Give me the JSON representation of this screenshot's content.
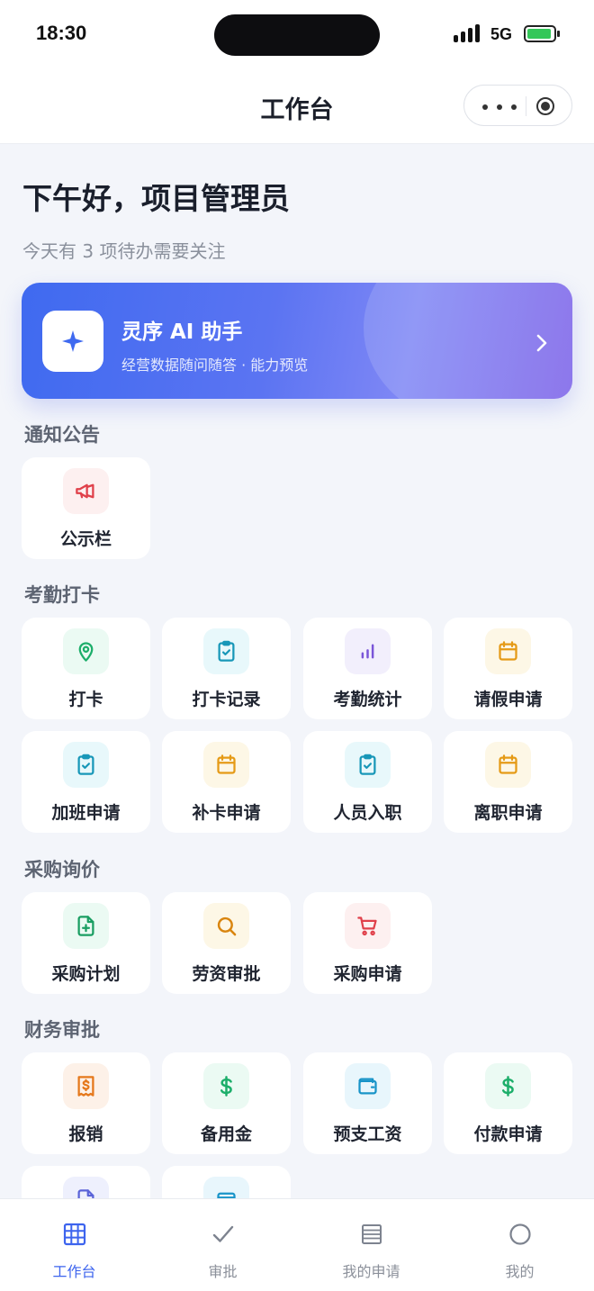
{
  "status_bar": {
    "time": "18:30",
    "network": "5G"
  },
  "nav": {
    "title": "工作台"
  },
  "header": {
    "greeting": "下午好，项目管理员",
    "subtitle": "今天有 3 项待办需要关注"
  },
  "ai_card": {
    "title": "灵序 AI 助手",
    "subtitle": "经营数据随问随答 · 能力预览"
  },
  "sections": [
    {
      "title": "通知公告",
      "items": [
        {
          "label": "公示栏",
          "icon": "megaphone-icon"
        }
      ]
    },
    {
      "title": "考勤打卡",
      "items": [
        {
          "label": "打卡",
          "icon": "location-pin-icon"
        },
        {
          "label": "打卡记录",
          "icon": "clipboard-check-icon"
        },
        {
          "label": "考勤统计",
          "icon": "bar-chart-icon"
        },
        {
          "label": "请假申请",
          "icon": "calendar-icon"
        },
        {
          "label": "加班申请",
          "icon": "clipboard-check-icon"
        },
        {
          "label": "补卡申请",
          "icon": "calendar-icon"
        },
        {
          "label": "人员入职",
          "icon": "clipboard-check-icon"
        },
        {
          "label": "离职申请",
          "icon": "calendar-icon"
        }
      ]
    },
    {
      "title": "采购询价",
      "items": [
        {
          "label": "采购计划",
          "icon": "file-plus-icon"
        },
        {
          "label": "劳资审批",
          "icon": "search-icon"
        },
        {
          "label": "采购申请",
          "icon": "shopping-cart-icon"
        }
      ]
    },
    {
      "title": "财务审批",
      "items": [
        {
          "label": "报销",
          "icon": "receipt-icon"
        },
        {
          "label": "备用金",
          "icon": "dollar-icon"
        },
        {
          "label": "预支工资",
          "icon": "wallet-icon"
        },
        {
          "label": "付款申请",
          "icon": "dollar-icon"
        },
        {
          "label": "",
          "icon": "document-icon"
        },
        {
          "label": "",
          "icon": "card-icon"
        }
      ]
    }
  ],
  "tab_bar": [
    {
      "label": "工作台",
      "icon": "grid-icon",
      "active": true
    },
    {
      "label": "审批",
      "icon": "check-icon",
      "active": false
    },
    {
      "label": "我的申请",
      "icon": "list-icon",
      "active": false
    },
    {
      "label": "我的",
      "icon": "profile-circle-icon",
      "active": false
    }
  ],
  "colors": {
    "accent": "#3d64ee",
    "ai_gradient_start": "#3f6af0",
    "ai_gradient_end": "#7b61e8",
    "page_background": "#f3f5fa"
  }
}
